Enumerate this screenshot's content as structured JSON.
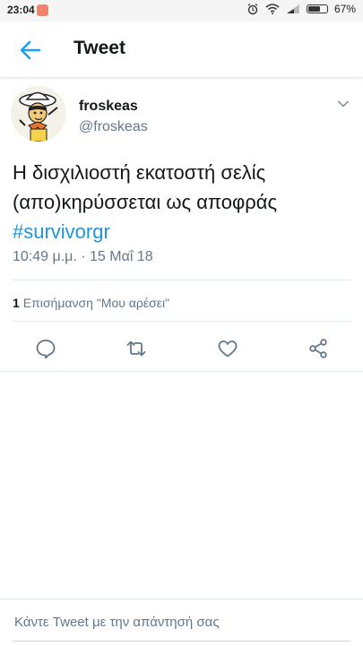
{
  "status_bar": {
    "time": "23:04",
    "battery": "67%",
    "battery_level": 0.67
  },
  "header": {
    "title": "Tweet"
  },
  "tweet": {
    "author_name": "froskeas",
    "author_handle": "@froskeas",
    "text": "Η δισχιλιοστή εκατοστή σελίς (απο)κηρύσσεται ως αποφράς",
    "hashtag": "#survivorgr",
    "timestamp": "10:49 μ.μ. · 15 Μαΐ 18"
  },
  "engagement": {
    "likes_count": "1",
    "likes_label": "Επισήμανση \"Μου αρέσει\""
  },
  "reply": {
    "placeholder": "Κάντε Tweet με την απάντησή σας"
  },
  "colors": {
    "accent": "#1da1f2",
    "hashtag": "#1b95e0",
    "secondary_text": "#657786"
  },
  "icons": [
    "back-arrow-icon",
    "chevron-down-icon",
    "reply-icon",
    "retweet-icon",
    "like-icon",
    "share-icon"
  ]
}
